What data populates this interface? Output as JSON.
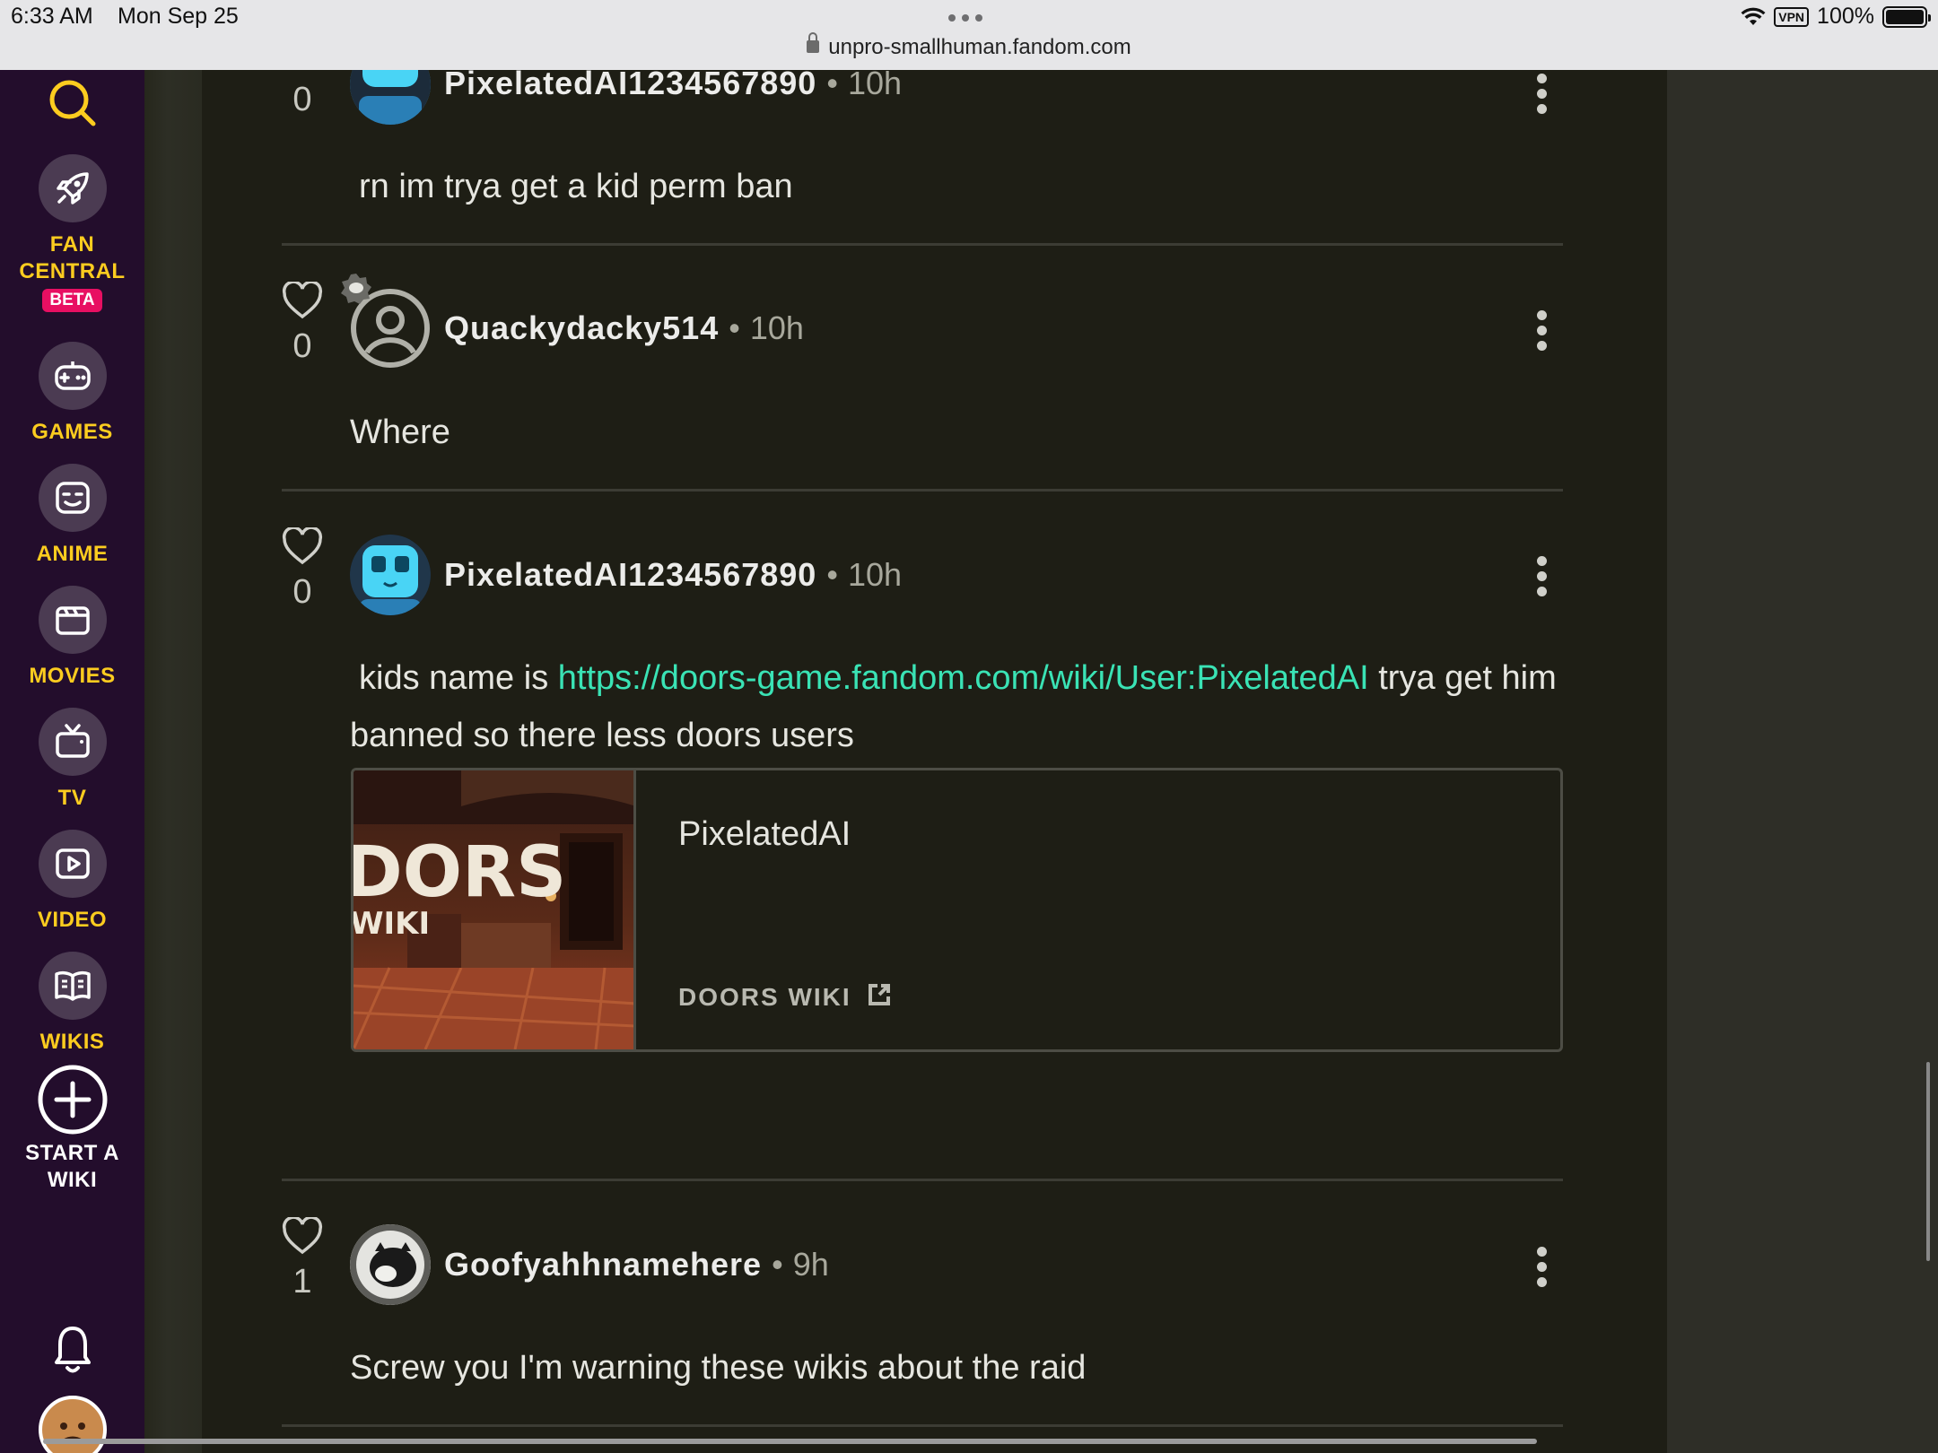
{
  "status_bar": {
    "time": "6:33 AM",
    "date": "Mon Sep 25",
    "url": "unpro-smallhuman.fandom.com",
    "vpn": "VPN",
    "battery": "100%"
  },
  "rail": {
    "fan_central": {
      "line1": "FAN",
      "line2": "CENTRAL",
      "badge": "BETA",
      "icon": "rocket-icon"
    },
    "items": [
      {
        "label": "GAMES",
        "icon": "gamepad-icon"
      },
      {
        "label": "ANIME",
        "icon": "anime-face-icon"
      },
      {
        "label": "MOVIES",
        "icon": "clapperboard-icon"
      },
      {
        "label": "TV",
        "icon": "tv-icon"
      },
      {
        "label": "VIDEO",
        "icon": "play-icon"
      },
      {
        "label": "WIKIS",
        "icon": "book-icon"
      }
    ],
    "start_wiki": {
      "line1": "START A",
      "line2": "WIKI",
      "icon": "plus-circle-icon"
    },
    "accent": "#fccc1f",
    "background": "#230d2c"
  },
  "comments": [
    {
      "likes": "0",
      "user": "PixelatedAI1234567890",
      "time": "10h",
      "text": "rn im trya get a kid perm ban"
    },
    {
      "likes": "0",
      "user": "Quackydacky514",
      "time": "10h",
      "text": "Where"
    },
    {
      "likes": "0",
      "user": "PixelatedAI1234567890",
      "time": "10h",
      "text_before": "kids name is ",
      "link": "https://doors-game.fandom.com/wiki/User:PixelatedAI",
      "text_after": " trya get him banned so there less doors users",
      "card": {
        "title": "PixelatedAI",
        "source": "DOORS WIKI",
        "thumb_text_1": "DORS",
        "thumb_text_2": "WIKI"
      }
    },
    {
      "likes": "1",
      "user": "Goofyahhnamehere",
      "time": "9h",
      "text": "Screw you I'm warning these wikis about the raid"
    }
  ],
  "colors": {
    "link": "#3ae3b5",
    "beta": "#e80f62",
    "page_bg": "#1e1e15"
  },
  "separator": "•"
}
